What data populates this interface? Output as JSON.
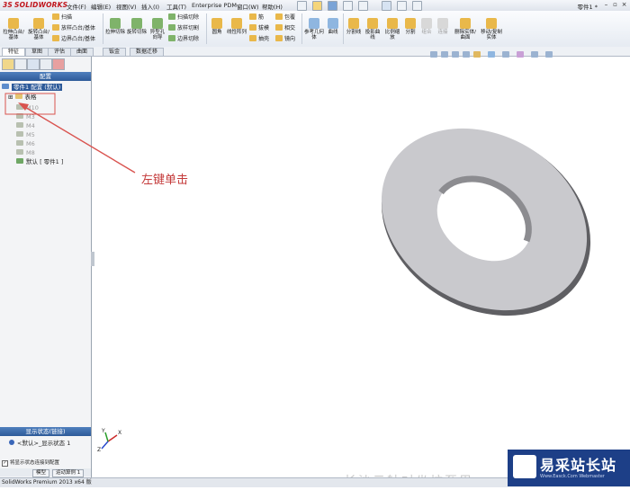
{
  "app": {
    "logo_text": "SOLIDWORKS",
    "logo_mark": "3S",
    "document_title": "零件1 *"
  },
  "menu": [
    "文件(F)",
    "编辑(E)",
    "视图(V)",
    "插入(I)",
    "工具(T)",
    "Enterprise PDM",
    "窗口(W)",
    "帮助(H)"
  ],
  "ribbon": {
    "large_buttons": [
      "拉伸凸台/基体",
      "旋转凸台/基体",
      "拉伸切除",
      "旋转切除",
      "异型孔向导",
      "圆角",
      "线性阵列",
      "参考几何体",
      "曲线",
      "分割线",
      "投影曲线",
      "比例缩放",
      "分割",
      "组合",
      "连接",
      "删除实体/曲面",
      "移动/复制实体"
    ],
    "small_buttons": [
      "扫描",
      "放样凸台/基体",
      "边界凸台/基体",
      "扫描切除",
      "放样切割",
      "边界切除",
      "筋",
      "拔模",
      "抽壳",
      "包覆",
      "相交",
      "镜向"
    ]
  },
  "command_tabs": [
    "特征",
    "草图",
    "评估",
    "曲面",
    "钣金",
    "数据迁移"
  ],
  "panel": {
    "header": "配置",
    "tree": {
      "root": "零件1 配置 (默认)",
      "table": "表格",
      "items": [
        "M10",
        "M3",
        "M4",
        "M5",
        "M6",
        "M8"
      ],
      "default": "默认 [ 零件1 ]"
    },
    "display_state": {
      "header": "显示状态(链接)",
      "item": "<默认>_显示状态 1",
      "checkbox": "将显示状态连接到配置"
    },
    "bottom_tabs": [
      "模型",
      "运动算例 1"
    ]
  },
  "annotation": {
    "text": "左键单击",
    "color": "#c43a3a"
  },
  "status": "SolidWorks Premium 2013 x64 版",
  "caption": "长沙云轴对坐坊至里",
  "watermark": {
    "title": "易采站长站",
    "subtitle": "Www.Easck.Com Webmaster"
  },
  "triad": {
    "x": "X",
    "y": "Y",
    "z": "Z"
  },
  "colors": {
    "accent": "#2d5a99",
    "annotation": "#c43a3a",
    "watermark_bg": "#1d3f87"
  }
}
